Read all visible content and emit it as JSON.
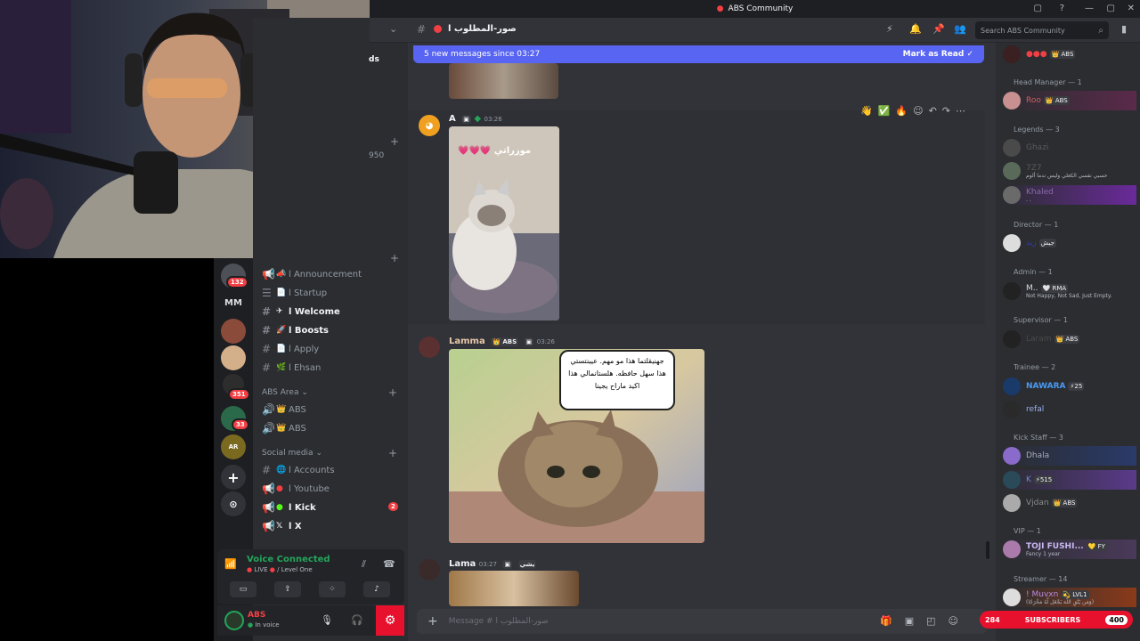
{
  "window": {
    "title": "ABS Community"
  },
  "server": {
    "search_placeholder": "Search ABS Community"
  },
  "channel": {
    "name": "صور-المطلوب ا",
    "compose_placeholder": "Message # صور-المطلوب ا"
  },
  "banner": {
    "text": "5 new messages since 03:27",
    "action": "Mark as Read"
  },
  "guilds": {
    "badge1": "132",
    "mm": "MM",
    "badge2": "351",
    "badge3": "33",
    "ar": "AR"
  },
  "channels": {
    "items": [
      {
        "label": "l Announcement",
        "emoji": "📣",
        "type": "announce",
        "unread": false
      },
      {
        "label": "l Startup",
        "emoji": "📄",
        "type": "rules",
        "unread": false
      },
      {
        "label": "l Welcome",
        "emoji": "✈",
        "type": "text",
        "unread": true
      },
      {
        "label": "l Boosts",
        "emoji": "🚀",
        "type": "text",
        "unread": true
      },
      {
        "label": "l Apply",
        "emoji": "📄",
        "type": "text",
        "unread": false
      },
      {
        "label": "l Ehsan",
        "emoji": "🌿",
        "type": "text",
        "unread": false
      }
    ],
    "area_cat": "ABS Area",
    "area": [
      {
        "label": "ABS",
        "emoji": "👑"
      },
      {
        "label": "ABS",
        "emoji": "👑"
      }
    ],
    "social_cat": "Social media",
    "social": [
      {
        "label": "l Accounts",
        "emoji": "🌐",
        "unread": false
      },
      {
        "label": "l Youtube",
        "emoji": "●",
        "unread": false
      },
      {
        "label": "l Kick",
        "emoji": "●",
        "unread": true,
        "badge": "2"
      },
      {
        "label": "l X",
        "emoji": "𝕏",
        "unread": true
      }
    ],
    "partial": {
      "a": "ds",
      "b": "950"
    }
  },
  "voice": {
    "status": "Voice Connected",
    "live": "LIVE",
    "channel": "/ Level One"
  },
  "user": {
    "name": "ABS",
    "status": "In voice"
  },
  "messages": [
    {
      "author": "A",
      "time": "03:26",
      "caption": "موزراتي 💗💗💗"
    },
    {
      "author": "Lamma",
      "time": "03:26",
      "tag": "ABS",
      "caption": "جهنيقلتما هذا مو مهم. عيينتستي هذا سهل حافظه. هلستانمالي هذا اكيد ماراح يجينا"
    },
    {
      "author": "Lama",
      "time": "03:27",
      "tag": "يشي"
    }
  ],
  "members": {
    "groups": [
      {
        "label": "Head Manager — 1"
      },
      {
        "label": "Legends — 3"
      },
      {
        "label": "Director — 1"
      },
      {
        "label": "Admin — 1"
      },
      {
        "label": "Supervisor — 1"
      },
      {
        "label": "Trainee — 2"
      },
      {
        "label": "Kick Staff — 3"
      },
      {
        "label": "VIP — 1"
      },
      {
        "label": "Streamer — 14"
      }
    ],
    "top": {
      "tag": "ABS"
    },
    "head": {
      "name": "Roo",
      "tag": "ABS"
    },
    "legends": [
      {
        "name": "Ghazi"
      },
      {
        "name": "7Z7",
        "sub": "حسبي نفسي الكعلي وليس ندما ألوم"
      },
      {
        "name": "Khaled",
        "sub": ". ."
      }
    ],
    "director": {
      "name": "زيد",
      "tag": "جيش"
    },
    "admin": {
      "name": "M..",
      "tag": "RMA",
      "sub": "Not Happy, Not Sad, Just Empty."
    },
    "supervisor": {
      "name": "Laram",
      "tag": "ABS"
    },
    "trainee": [
      {
        "name": "NAWARA",
        "tag": "25"
      },
      {
        "name": "refal"
      }
    ],
    "kick": [
      {
        "name": "Dhala"
      },
      {
        "name": "K",
        "tag": "515"
      },
      {
        "name": "Vjdan",
        "tag": "ABS"
      }
    ],
    "vip": {
      "name": "TOJI FUSHI...",
      "tag": "FY",
      "sub": "Fancy 1 year"
    },
    "streamer": {
      "name": "! Muvxn",
      "tag": "LVL1",
      "sub": "(وَمَن يَتَّقِ اللَّهَ يَجْعَل لَّهُ مَخْرَجًا)"
    }
  },
  "subscribers": {
    "left": "284",
    "label": "SUBSCRIBERS",
    "right": "400"
  },
  "colors": {
    "accent": "#5865f2",
    "bg": "#313338",
    "sidebar": "#2b2d31",
    "danger": "#f23f43",
    "green": "#23a55a"
  }
}
